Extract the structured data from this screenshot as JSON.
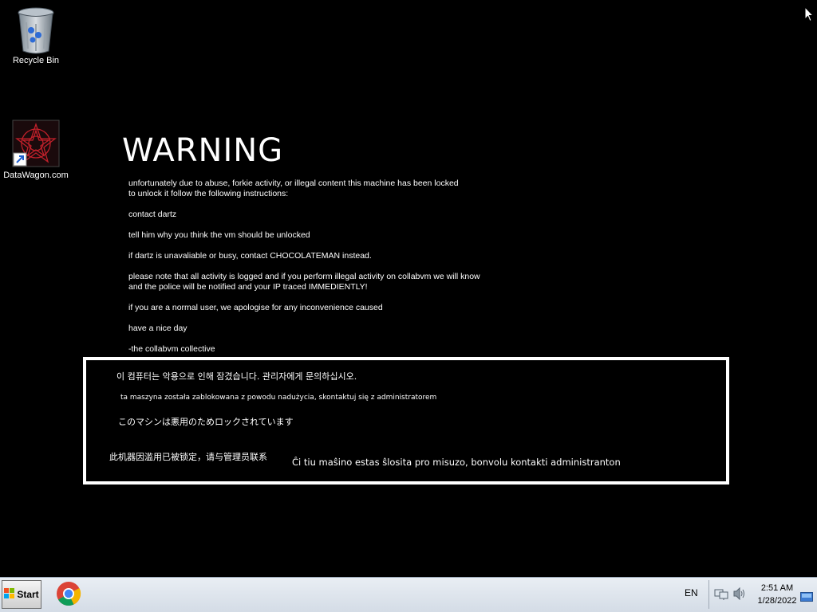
{
  "desktop": {
    "icons": [
      {
        "label": "Recycle Bin",
        "icon": "recycle-bin-icon"
      },
      {
        "label": "DataWagon.com",
        "icon": "datawagon-shortcut-icon"
      }
    ]
  },
  "warning": {
    "title": "WARNING",
    "paragraphs": [
      "unfortunately due to abuse, forkie activity, or illegal content this machine has been locked\nto unlock it follow the following instructions:",
      "contact dartz",
      "tell him why you think the vm should be unlocked",
      "if dartz is unavaliable or busy, contact CHOCOLATEMAN instead.",
      "please note that all activity is logged and if you perform illegal activity on collabvm we will know\nand the police will be notified and your IP traced IMMEDIENTLY!",
      "if you are a normal user, we apologise for any inconvenience caused",
      "have a nice day",
      "-the collabvm collective"
    ]
  },
  "translations": {
    "korean": "이 컴퓨터는 악용으로 인해 잠겼습니다. 관리자에게 문의하십시오.",
    "polish": "ta maszyna została zablokowana z powodu nadużycia, skontaktuj się z administratorem",
    "japanese": "このマシンは悪用のためロックされています",
    "chinese": "此机器因滥用已被锁定，请与管理员联系",
    "esperanto": "Ĉi tiu maŝino estas ŝlosita pro misuzo, bonvolu kontakti administranton"
  },
  "taskbar": {
    "start_label": "Start",
    "pinned": [
      {
        "icon": "chrome-icon"
      }
    ],
    "language": "EN",
    "time": "2:51 AM",
    "date": "1/28/2022"
  },
  "colors": {
    "desktop_bg": "#000000",
    "text": "#ffffff",
    "taskbar_bg": "#dfe6ee"
  }
}
